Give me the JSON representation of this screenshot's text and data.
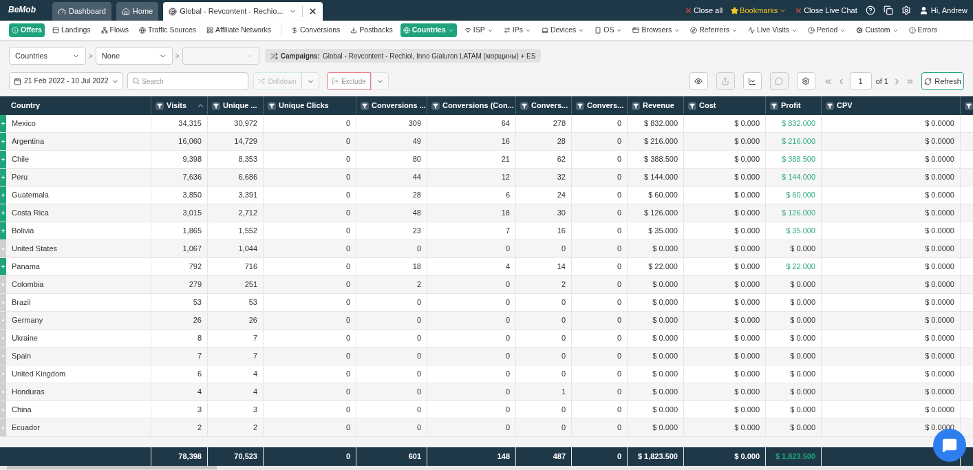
{
  "topbar": {
    "logo": "BeMob",
    "tabs": [
      {
        "label": "Dashboard",
        "selected": false
      },
      {
        "label": "Home",
        "selected": false
      },
      {
        "label": "Global - Revcontent - Rechio...",
        "selected": true
      }
    ],
    "actions": [
      "Close all",
      "Bookmarks",
      "Close Live Chat"
    ],
    "user": "Hi, Andrew"
  },
  "nav": {
    "groups": [
      [
        {
          "label": "Offers",
          "selected": true,
          "caret": false
        },
        {
          "label": "Landings",
          "selected": false,
          "caret": false
        },
        {
          "label": "Flows",
          "selected": false,
          "caret": false
        },
        {
          "label": "Traffic Sources",
          "selected": false,
          "caret": false
        },
        {
          "label": "Affiliate Networks",
          "selected": false,
          "caret": false
        }
      ],
      [
        {
          "label": "Conversions",
          "selected": false,
          "caret": false
        },
        {
          "label": "Postbacks",
          "selected": false,
          "caret": false
        },
        {
          "label": "Countries",
          "selected": true,
          "caret": true
        },
        {
          "label": "ISP",
          "selected": false,
          "caret": true
        },
        {
          "label": "IPs",
          "selected": false,
          "caret": true
        },
        {
          "label": "Devices",
          "selected": false,
          "caret": true
        },
        {
          "label": "OS",
          "selected": false,
          "caret": true
        },
        {
          "label": "Browsers",
          "selected": false,
          "caret": true
        },
        {
          "label": "Referrers",
          "selected": false,
          "caret": true
        },
        {
          "label": "Live Visits",
          "selected": false,
          "caret": true
        },
        {
          "label": "Period",
          "selected": false,
          "caret": true
        },
        {
          "label": "Custom",
          "selected": false,
          "caret": true
        },
        {
          "label": "Errors",
          "selected": false,
          "caret": false
        }
      ]
    ]
  },
  "grouping": {
    "selects": [
      {
        "value": "Countries",
        "disabled": false
      },
      {
        "value": "None",
        "disabled": false
      },
      {
        "disabled": true
      }
    ],
    "separator": ">",
    "campaign_label": "Campaigns:",
    "campaign": "Global - Revcontent - Rechiol, Inno Gialuron LATAM (морщины) + ES"
  },
  "toolbar": {
    "date_range": "21 Feb 2022 - 10 Jul 2022",
    "search_placeholder": "Search",
    "drilldown": {
      "label": "Drilldown",
      "disabled": true
    },
    "exclude": {
      "label": "Exclude",
      "disabled": false
    },
    "page": "1",
    "page_of": "of 1",
    "refresh": "Refresh"
  },
  "table": {
    "columns": [
      {
        "label": "Country",
        "filter": false,
        "sorted": false
      },
      {
        "label": "Visits",
        "filter": true,
        "sorted": true
      },
      {
        "label": "Unique ...",
        "filter": true,
        "sorted": false
      },
      {
        "label": "Unique Clicks",
        "filter": true,
        "sorted": false
      },
      {
        "label": "Conversions ...",
        "filter": true,
        "sorted": false
      },
      {
        "label": "Conversions (Con...",
        "filter": true,
        "sorted": false
      },
      {
        "label": "Convers...",
        "filter": true,
        "sorted": false
      },
      {
        "label": "Convers...",
        "filter": true,
        "sorted": false
      },
      {
        "label": "Revenue",
        "filter": true,
        "sorted": false
      },
      {
        "label": "Cost",
        "filter": true,
        "sorted": false
      },
      {
        "label": "Profit",
        "filter": true,
        "sorted": false
      },
      {
        "label": "CPV",
        "filter": true,
        "sorted": false
      },
      {
        "filter": true,
        "sorted": false
      }
    ],
    "rows": [
      {
        "expandable": true,
        "profit_positive": true,
        "cells": [
          "Mexico",
          "34,315",
          "30,972",
          "0",
          "309",
          "64",
          "278",
          "0",
          "$ 832.000",
          "$ 0.000",
          "$ 832.000",
          "$ 0.0000"
        ]
      },
      {
        "expandable": true,
        "profit_positive": true,
        "cells": [
          "Argentina",
          "16,060",
          "14,729",
          "0",
          "49",
          "16",
          "28",
          "0",
          "$ 216.000",
          "$ 0.000",
          "$ 216.000",
          "$ 0.0000"
        ]
      },
      {
        "expandable": true,
        "profit_positive": true,
        "cells": [
          "Chile",
          "9,398",
          "8,353",
          "0",
          "80",
          "21",
          "62",
          "0",
          "$ 388.500",
          "$ 0.000",
          "$ 388.500",
          "$ 0.0000"
        ]
      },
      {
        "expandable": true,
        "profit_positive": true,
        "cells": [
          "Peru",
          "7,636",
          "6,686",
          "0",
          "44",
          "12",
          "32",
          "0",
          "$ 144.000",
          "$ 0.000",
          "$ 144.000",
          "$ 0.0000"
        ]
      },
      {
        "expandable": true,
        "profit_positive": true,
        "cells": [
          "Guatemala",
          "3,850",
          "3,391",
          "0",
          "28",
          "6",
          "24",
          "0",
          "$ 60.000",
          "$ 0.000",
          "$ 60.000",
          "$ 0.0000"
        ]
      },
      {
        "expandable": true,
        "profit_positive": true,
        "cells": [
          "Costa Rica",
          "3,015",
          "2,712",
          "0",
          "48",
          "18",
          "30",
          "0",
          "$ 126.000",
          "$ 0.000",
          "$ 126.000",
          "$ 0.0000"
        ]
      },
      {
        "expandable": true,
        "profit_positive": true,
        "cells": [
          "Bolivia",
          "1,865",
          "1,552",
          "0",
          "23",
          "7",
          "16",
          "0",
          "$ 35.000",
          "$ 0.000",
          "$ 35.000",
          "$ 0.0000"
        ]
      },
      {
        "expandable": false,
        "profit_positive": false,
        "cells": [
          "United States",
          "1,067",
          "1,044",
          "0",
          "0",
          "0",
          "0",
          "0",
          "$ 0.000",
          "$ 0.000",
          "$ 0.000",
          "$ 0.0000"
        ]
      },
      {
        "expandable": true,
        "profit_positive": true,
        "cells": [
          "Panama",
          "792",
          "716",
          "0",
          "18",
          "4",
          "14",
          "0",
          "$ 22.000",
          "$ 0.000",
          "$ 22.000",
          "$ 0.0000"
        ]
      },
      {
        "expandable": false,
        "profit_positive": false,
        "cells": [
          "Colombia",
          "279",
          "251",
          "0",
          "2",
          "0",
          "2",
          "0",
          "$ 0.000",
          "$ 0.000",
          "$ 0.000",
          "$ 0.0000"
        ]
      },
      {
        "expandable": false,
        "profit_positive": false,
        "cells": [
          "Brazil",
          "53",
          "53",
          "0",
          "0",
          "0",
          "0",
          "0",
          "$ 0.000",
          "$ 0.000",
          "$ 0.000",
          "$ 0.0000"
        ]
      },
      {
        "expandable": false,
        "profit_positive": false,
        "cells": [
          "Germany",
          "26",
          "26",
          "0",
          "0",
          "0",
          "0",
          "0",
          "$ 0.000",
          "$ 0.000",
          "$ 0.000",
          "$ 0.0000"
        ]
      },
      {
        "expandable": false,
        "profit_positive": false,
        "cells": [
          "Ukraine",
          "8",
          "7",
          "0",
          "0",
          "0",
          "0",
          "0",
          "$ 0.000",
          "$ 0.000",
          "$ 0.000",
          "$ 0.0000"
        ]
      },
      {
        "expandable": false,
        "profit_positive": false,
        "cells": [
          "Spain",
          "7",
          "7",
          "0",
          "0",
          "0",
          "0",
          "0",
          "$ 0.000",
          "$ 0.000",
          "$ 0.000",
          "$ 0.0000"
        ]
      },
      {
        "expandable": false,
        "profit_positive": false,
        "cells": [
          "United Kingdom",
          "6",
          "4",
          "0",
          "0",
          "0",
          "0",
          "0",
          "$ 0.000",
          "$ 0.000",
          "$ 0.000",
          "$ 0.0000"
        ]
      },
      {
        "expandable": false,
        "profit_positive": false,
        "cells": [
          "Honduras",
          "4",
          "4",
          "0",
          "0",
          "0",
          "1",
          "0",
          "$ 0.000",
          "$ 0.000",
          "$ 0.000",
          "$ 0.0000"
        ]
      },
      {
        "expandable": false,
        "profit_positive": false,
        "cells": [
          "China",
          "3",
          "3",
          "0",
          "0",
          "0",
          "0",
          "0",
          "$ 0.000",
          "$ 0.000",
          "$ 0.000",
          "$ 0.0000"
        ]
      },
      {
        "expandable": false,
        "profit_positive": false,
        "cells": [
          "Ecuador",
          "2",
          "2",
          "0",
          "0",
          "0",
          "0",
          "0",
          "$ 0.000",
          "$ 0.000",
          "$ 0.000",
          "$ 0.0000"
        ]
      }
    ],
    "totals": {
      "profit_positive": true,
      "cells": [
        "",
        "78,398",
        "70,523",
        "0",
        "601",
        "148",
        "487",
        "0",
        "$ 1,823.500",
        "$ 0.000",
        "$ 1,823.500",
        ""
      ]
    }
  }
}
